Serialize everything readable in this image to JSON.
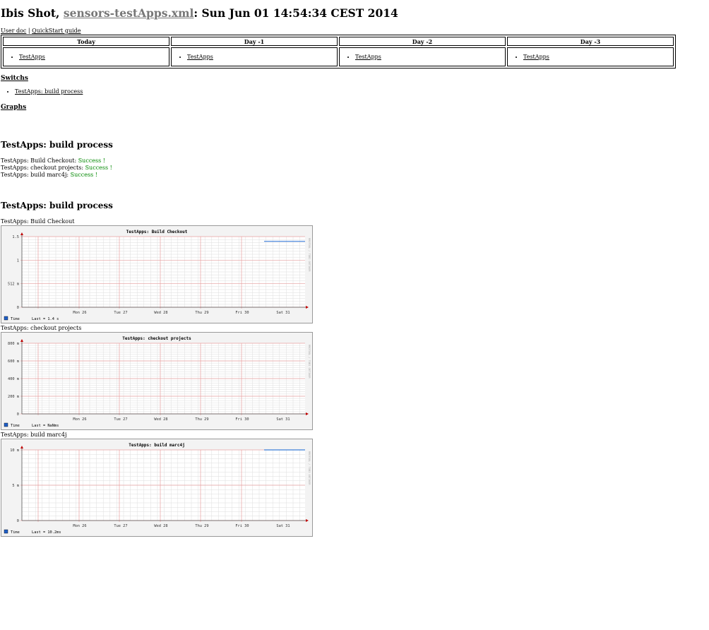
{
  "header": {
    "prefix": "Ibis Shot, ",
    "file": "sensors-testApps.xml",
    "suffix": ": Sun Jun 01 14:54:34 CEST 2014"
  },
  "links": {
    "user_doc": "User doc",
    "separator": "|",
    "quickstart": "QuickStart guide"
  },
  "days": [
    {
      "header": "Today",
      "item": "TestApps"
    },
    {
      "header": "Day -1",
      "item": "TestApps"
    },
    {
      "header": "Day -2",
      "item": "TestApps"
    },
    {
      "header": "Day -3",
      "item": "TestApps"
    }
  ],
  "switches": {
    "title": "Switchs",
    "items": [
      "TestApps: build process"
    ]
  },
  "graphs_title": "Graphs",
  "status_section": {
    "title": "TestApps: build process",
    "lines": [
      {
        "label": "TestApps: Build Checkout: ",
        "status": "Success !"
      },
      {
        "label": "TestApps: checkout projects: ",
        "status": "Success !"
      },
      {
        "label": "TestApps: build marc4j: ",
        "status": "Success !"
      }
    ]
  },
  "graph_section": {
    "title": "TestApps: build process",
    "captions": [
      "TestApps: Build Checkout",
      "TestApps: checkout projects",
      "TestApps: build marc4j"
    ]
  },
  "colors": {
    "success": "#008800",
    "link_gray": "#777777",
    "series_line": "#3b7dd8",
    "legend_swatch": "#1f5fc8",
    "major_grid": "#e8a0a0",
    "minor_grid": "#dddddd"
  },
  "chart_data": [
    {
      "type": "line",
      "title": "TestApps: Build Checkout",
      "x_ticks": [
        "Mon 26",
        "Tue 27",
        "Wed 28",
        "Thu 29",
        "Fri 30",
        "Sat 31"
      ],
      "y_ticks": [
        {
          "value": 0,
          "label": "0"
        },
        {
          "value": 0.5,
          "label": "512 m"
        },
        {
          "value": 1,
          "label": "1"
        },
        {
          "value": 1.5,
          "label": "1.5"
        }
      ],
      "ylim": [
        0,
        1.5
      ],
      "series": [
        {
          "name": "Time",
          "x_range": [
            "Sat 31",
            "end"
          ],
          "y": 1.4
        }
      ],
      "legend": {
        "label": "Time",
        "last_text": "Last = 1.4 s"
      },
      "watermark": "RRDTOOL / TOBI OETIKER",
      "grid": true
    },
    {
      "type": "line",
      "title": "TestApps: checkout projects",
      "x_ticks": [
        "Mon 26",
        "Tue 27",
        "Wed 28",
        "Thu 29",
        "Fri 30",
        "Sat 31"
      ],
      "y_ticks": [
        {
          "value": 0,
          "label": "0"
        },
        {
          "value": 0.2,
          "label": "200 m"
        },
        {
          "value": 0.4,
          "label": "400 m"
        },
        {
          "value": 0.6,
          "label": "600 m"
        },
        {
          "value": 0.8,
          "label": "800 m"
        }
      ],
      "ylim": [
        0,
        0.8
      ],
      "series": [],
      "legend": {
        "label": "Time",
        "last_text": "Last = NaNms"
      },
      "watermark": "RRDTOOL / TOBI OETIKER",
      "grid": true
    },
    {
      "type": "line",
      "title": "TestApps: build marc4j",
      "x_ticks": [
        "Mon 26",
        "Tue 27",
        "Wed 28",
        "Thu 29",
        "Fri 30",
        "Sat 31"
      ],
      "y_ticks": [
        {
          "value": 0,
          "label": "0"
        },
        {
          "value": 5,
          "label": "5 m"
        },
        {
          "value": 10,
          "label": "10 m"
        }
      ],
      "ylim": [
        0,
        10
      ],
      "series": [
        {
          "name": "Time",
          "x_range": [
            "Sat 31",
            "end"
          ],
          "y": 10
        }
      ],
      "legend": {
        "label": "Time",
        "last_text": "Last = 10.2ms"
      },
      "watermark": "RRDTOOL / TOBI OETIKER",
      "grid": true
    }
  ]
}
